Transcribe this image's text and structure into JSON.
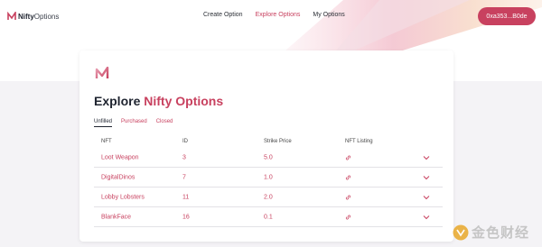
{
  "header": {
    "logo_bold": "Nifty",
    "logo_light": "Options",
    "nav": [
      {
        "label": "Create Option",
        "active": false
      },
      {
        "label": "Explore Options",
        "active": true
      },
      {
        "label": "My Options",
        "active": false
      }
    ],
    "wallet_label": "0xa353...B0de"
  },
  "main": {
    "title_prefix": "Explore",
    "title_accent": "Nifty Options",
    "tabs": [
      {
        "label": "Unfilled",
        "active": true
      },
      {
        "label": "Purchased",
        "active": false
      },
      {
        "label": "Closed",
        "active": false
      }
    ],
    "columns": [
      "NFT",
      "ID",
      "Strike Price",
      "NFT Listing"
    ],
    "rows": [
      {
        "nft": "Loot Weapon",
        "id": "3",
        "strike": "5.0"
      },
      {
        "nft": "DigitalDinos",
        "id": "7",
        "strike": "1.0"
      },
      {
        "nft": "Lobby Lobsters",
        "id": "11",
        "strike": "2.0"
      },
      {
        "nft": "BlankFace",
        "id": "16",
        "strike": "0.1"
      }
    ]
  },
  "watermark": {
    "text": "金色财经"
  },
  "colors": {
    "accent": "#c8415f",
    "text": "#1f2430",
    "background": "#f4f3f6"
  },
  "icons": {
    "row_link": "link-icon",
    "row_expand": "chevron-down-icon"
  }
}
